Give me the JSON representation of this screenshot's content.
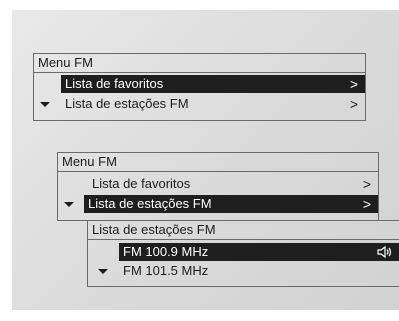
{
  "menu_top": {
    "title": "Menu FM",
    "items": [
      {
        "label": "Lista de favoritos",
        "chevron": ">",
        "selected": true
      },
      {
        "label": "Lista de estações FM",
        "chevron": ">",
        "selected": false
      }
    ]
  },
  "menu_mid": {
    "title": "Menu FM",
    "items": [
      {
        "label": "Lista de favoritos",
        "chevron": ">",
        "selected": false
      },
      {
        "label": "Lista de estações FM",
        "chevron": ">",
        "selected": true
      }
    ]
  },
  "station_list": {
    "title": "Lista de estações FM",
    "items": [
      {
        "label": "FM 100.9 MHz",
        "selected": true,
        "icon": "speaker-icon"
      },
      {
        "label": "FM 101.5 MHz",
        "selected": false
      }
    ]
  },
  "colors": {
    "highlight": "#1e1e1e",
    "text": "#1c1c1c",
    "border": "#6a6a6a"
  }
}
